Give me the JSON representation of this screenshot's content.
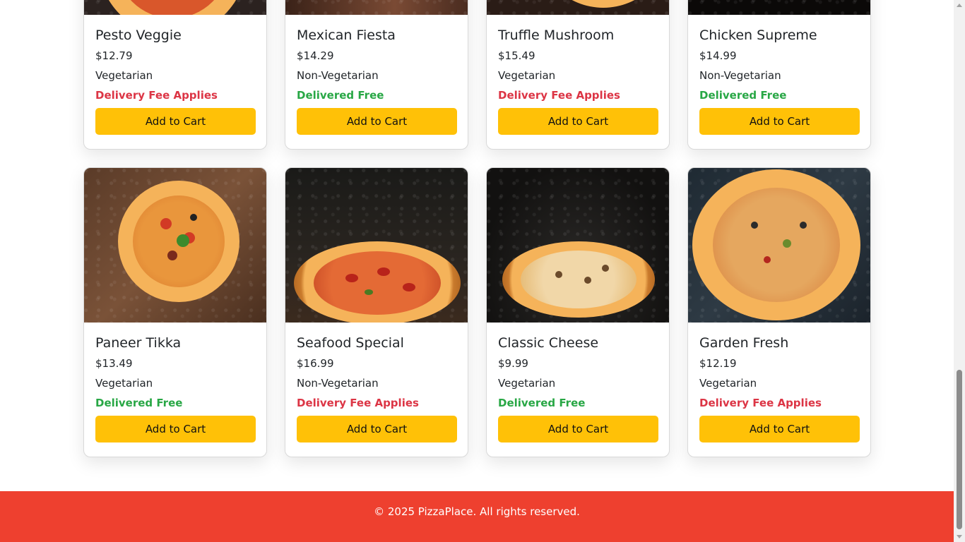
{
  "row1": [
    {
      "name": "Pesto Veggie",
      "price": "$12.79",
      "type": "Vegetarian",
      "delivery": "Delivery Fee Applies",
      "delivery_status": "fee",
      "button": "Add to Cart"
    },
    {
      "name": "Mexican Fiesta",
      "price": "$14.29",
      "type": "Non-Vegetarian",
      "delivery": "Delivered Free",
      "delivery_status": "free",
      "button": "Add to Cart"
    },
    {
      "name": "Truffle Mushroom",
      "price": "$15.49",
      "type": "Vegetarian",
      "delivery": "Delivery Fee Applies",
      "delivery_status": "fee",
      "button": "Add to Cart"
    },
    {
      "name": "Chicken Supreme",
      "price": "$14.99",
      "type": "Non-Vegetarian",
      "delivery": "Delivered Free",
      "delivery_status": "free",
      "button": "Add to Cart"
    }
  ],
  "row2": [
    {
      "name": "Paneer Tikka",
      "price": "$13.49",
      "type": "Vegetarian",
      "delivery": "Delivered Free",
      "delivery_status": "free",
      "button": "Add to Cart"
    },
    {
      "name": "Seafood Special",
      "price": "$16.99",
      "type": "Non-Vegetarian",
      "delivery": "Delivery Fee Applies",
      "delivery_status": "fee",
      "button": "Add to Cart"
    },
    {
      "name": "Classic Cheese",
      "price": "$9.99",
      "type": "Vegetarian",
      "delivery": "Delivered Free",
      "delivery_status": "free",
      "button": "Add to Cart"
    },
    {
      "name": "Garden Fresh",
      "price": "$12.19",
      "type": "Vegetarian",
      "delivery": "Delivery Fee Applies",
      "delivery_status": "fee",
      "button": "Add to Cart"
    }
  ],
  "footer": {
    "text": "© 2025 PizzaPlace. All rights reserved."
  },
  "colors": {
    "accent_button": "#ffc107",
    "footer_bg": "#ee402f",
    "free_green": "#28a745",
    "fee_red": "#dc3545"
  },
  "icons": [
    "scroll-up-arrow-icon",
    "scroll-down-arrow-icon"
  ]
}
